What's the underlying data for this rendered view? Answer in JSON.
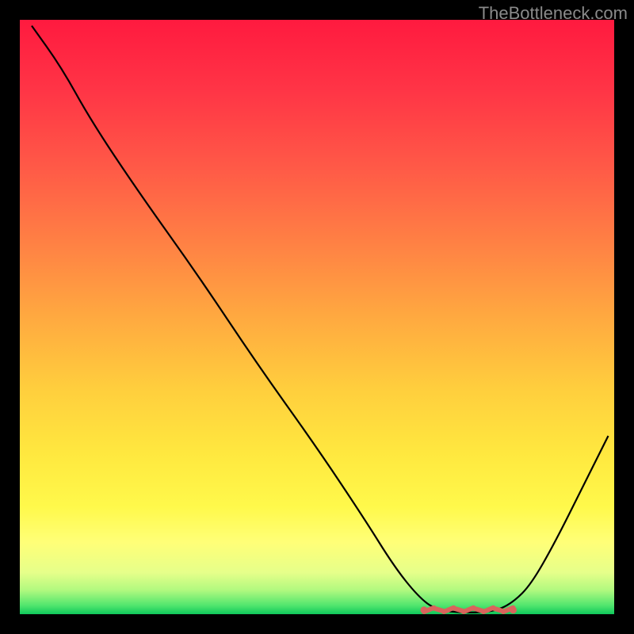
{
  "attribution": "TheBottleneck.com",
  "chart_data": {
    "type": "line",
    "title": "",
    "xlabel": "",
    "ylabel": "",
    "xlim": [
      0,
      100
    ],
    "ylim": [
      0,
      100
    ],
    "curve": [
      {
        "x": 2,
        "y": 99
      },
      {
        "x": 7,
        "y": 92
      },
      {
        "x": 12,
        "y": 83
      },
      {
        "x": 20,
        "y": 71
      },
      {
        "x": 30,
        "y": 57
      },
      {
        "x": 40,
        "y": 42
      },
      {
        "x": 50,
        "y": 28
      },
      {
        "x": 58,
        "y": 16
      },
      {
        "x": 63,
        "y": 8
      },
      {
        "x": 67,
        "y": 3
      },
      {
        "x": 70,
        "y": 0.7
      },
      {
        "x": 75,
        "y": 0.2
      },
      {
        "x": 80,
        "y": 0.5
      },
      {
        "x": 83,
        "y": 2
      },
      {
        "x": 86,
        "y": 5
      },
      {
        "x": 90,
        "y": 12
      },
      {
        "x": 95,
        "y": 22
      },
      {
        "x": 99,
        "y": 30
      }
    ],
    "optimal_marker": {
      "x_start": 68,
      "x_end": 83,
      "y": 0.7,
      "color": "#d9645c"
    },
    "gradient_stops": [
      {
        "offset": 0.0,
        "color": "#ff1a3f"
      },
      {
        "offset": 0.12,
        "color": "#ff3546"
      },
      {
        "offset": 0.25,
        "color": "#ff5a47"
      },
      {
        "offset": 0.38,
        "color": "#ff8244"
      },
      {
        "offset": 0.5,
        "color": "#ffa940"
      },
      {
        "offset": 0.62,
        "color": "#ffce3d"
      },
      {
        "offset": 0.73,
        "color": "#ffe83f"
      },
      {
        "offset": 0.82,
        "color": "#fff94b"
      },
      {
        "offset": 0.88,
        "color": "#ffff78"
      },
      {
        "offset": 0.93,
        "color": "#e6ff8a"
      },
      {
        "offset": 0.96,
        "color": "#b0f97f"
      },
      {
        "offset": 0.985,
        "color": "#52e66e"
      },
      {
        "offset": 1.0,
        "color": "#0fc85b"
      }
    ]
  }
}
